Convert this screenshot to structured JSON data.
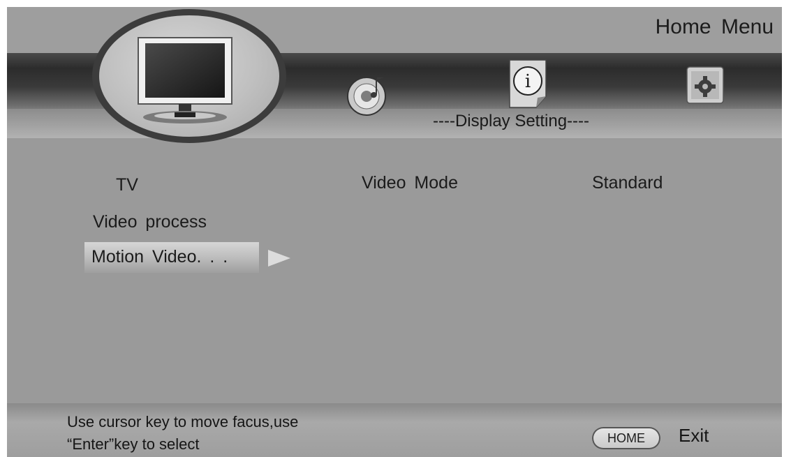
{
  "header": {
    "title": "Home Menu",
    "section_title": "----Display Setting----"
  },
  "categories": [
    {
      "icon": "tv-icon",
      "selected": true
    },
    {
      "icon": "music-disc-icon",
      "selected": false
    },
    {
      "icon": "info-icon",
      "selected": false
    },
    {
      "icon": "gear-icon",
      "selected": false
    }
  ],
  "menu": {
    "tv_label": "TV",
    "video_mode_label": "Video  Mode",
    "video_mode_value": "Standard",
    "video_process_label": "Video  process",
    "selected_item_label": "Motion  Video. . ."
  },
  "footer": {
    "hint_line_1": "Use cursor key to move facus,use",
    "hint_line_2": "“Enter”key to select",
    "home_key": "HOME",
    "exit_label": "Exit"
  },
  "colors": {
    "background": "#9a9a9a",
    "dark_band": "#2c2c2c",
    "highlight": "#c8c8c8"
  }
}
